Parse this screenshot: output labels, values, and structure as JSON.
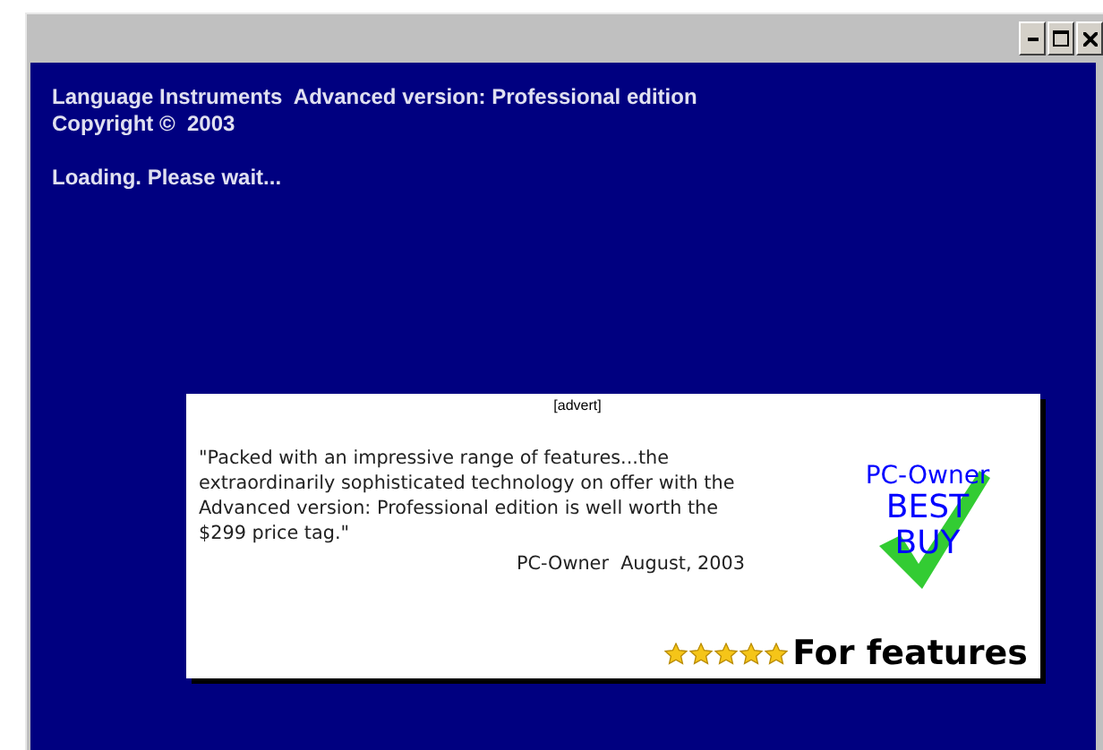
{
  "window": {
    "buttons": [
      {
        "kind": "minimize"
      },
      {
        "kind": "maximize"
      },
      {
        "kind": "close"
      }
    ]
  },
  "splash": {
    "lines": [
      "Language Instruments  Advanced version: Professional edition",
      "Copyright ©  2003"
    ],
    "status": "Loading. Please wait..."
  },
  "advert": {
    "label": "[advert]",
    "quote": "\"Packed with an impressive range of features...the extraordinarily sophisticated technology on offer with the Advanced version: Professional edition is well worth the $299 price tag.\"",
    "source": "PC-Owner  August, 2003",
    "badge": {
      "brand": "PC-Owner",
      "title": "BEST BUY"
    },
    "rating": {
      "stars": 5,
      "caption": "For features"
    }
  }
}
